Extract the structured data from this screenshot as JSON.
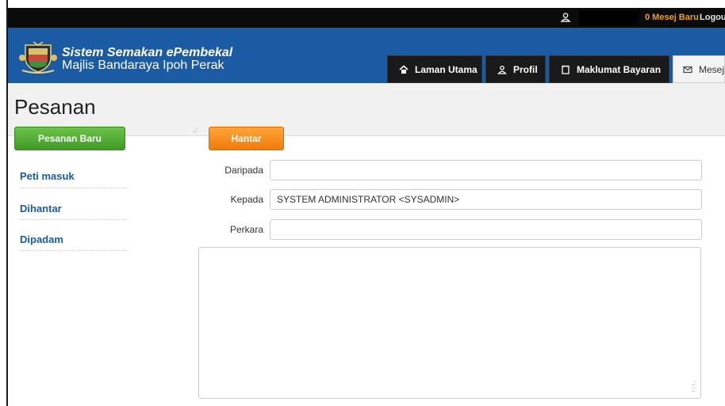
{
  "topbar": {
    "user_icon": "user-icon",
    "message_link": "0 Mesej Baru",
    "logout_link": "Logou"
  },
  "header": {
    "title": "Sistem Semakan ePembekal",
    "subtitle": "Majlis Bandaraya Ipoh Perak",
    "logo_icon": "crest-logo-icon"
  },
  "nav": {
    "tabs": [
      {
        "label": "Laman Utama",
        "icon": "home-icon"
      },
      {
        "label": "Profil",
        "icon": "user-icon"
      },
      {
        "label": "Maklumat Bayaran",
        "icon": "document-icon"
      },
      {
        "label": "Mesej",
        "icon": "mail-icon",
        "active": true
      }
    ]
  },
  "page": {
    "title": "Pesanan",
    "new_message_button": "Pesanan Baru",
    "send_button": "Hantar"
  },
  "sidebar": {
    "items": [
      {
        "label": "Peti masuk"
      },
      {
        "label": "Dihantar"
      },
      {
        "label": "Dipadam"
      }
    ]
  },
  "form": {
    "from_label": "Daripada",
    "from_value": "",
    "to_label": "Kepada",
    "to_value": "SYSTEM ADMINISTRATOR <SYSADMIN>",
    "subject_label": "Perkara",
    "subject_value": "",
    "body_value": ""
  },
  "colors": {
    "header_blue": "#1b5ba3",
    "green_button": "#4caf33",
    "orange_button": "#f7900f",
    "message_link": "#f0a020"
  }
}
